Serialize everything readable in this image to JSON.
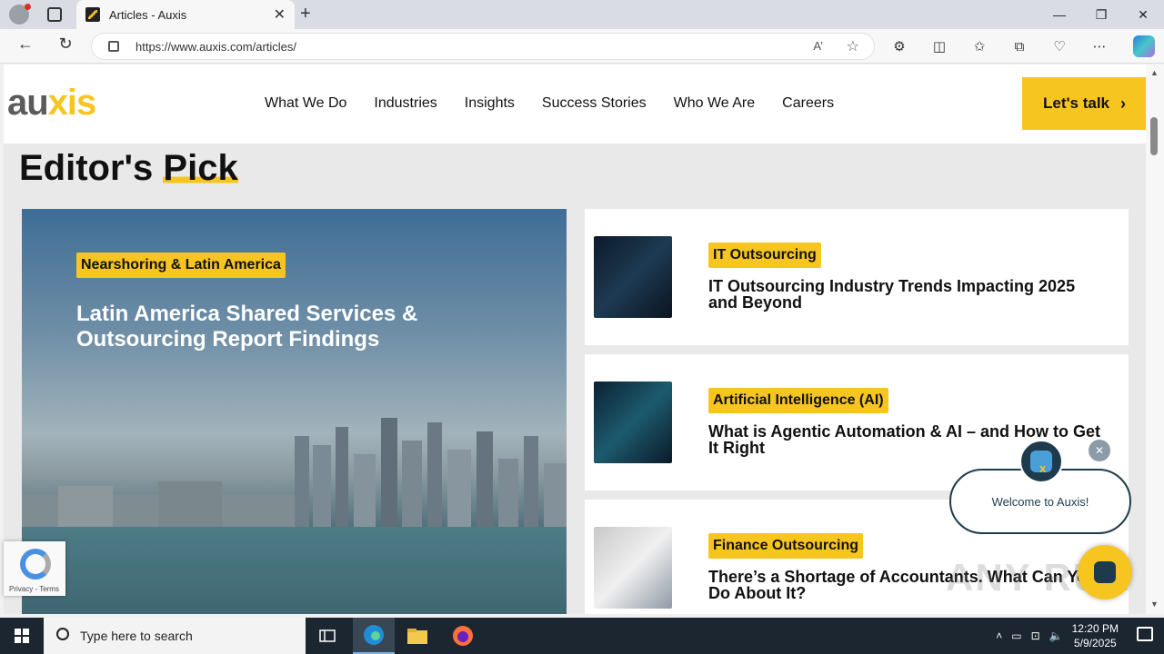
{
  "browser": {
    "tab_title": "Articles - Auxis",
    "url": "https://www.auxis.com/articles/",
    "read_aloud": "A’"
  },
  "site": {
    "logo_part1": "au",
    "logo_part2": "xis",
    "menu": [
      "What We Do",
      "Industries",
      "Insights",
      "Success Stories",
      "Who We Are",
      "Careers"
    ],
    "cta": "Let's talk",
    "section_title_part1": "Editor's ",
    "section_title_part2": "Pick"
  },
  "hero": {
    "tag": "Nearshoring & Latin America",
    "title": "Latin America Shared Services & Outsourcing Report Findings"
  },
  "cards": [
    {
      "tag": "IT Outsourcing",
      "title": "IT Outsourcing Industry Trends Impacting 2025 and Beyond"
    },
    {
      "tag": "Artificial Intelligence (AI)",
      "title": "What is Agentic Automation & AI – and How to Get It Right"
    },
    {
      "tag": "Finance Outsourcing",
      "title": "There’s a Shortage of Accountants. What Can You Do About It?"
    }
  ],
  "chat": {
    "welcome": "Welcome to Auxis!"
  },
  "recaptcha": {
    "text": "Privacy - Terms"
  },
  "watermark": "ANY RUN",
  "taskbar": {
    "search_placeholder": "Type here to search",
    "time": "12:20 PM",
    "date": "5/9/2025"
  },
  "colors": {
    "brand_yellow": "#f7c520",
    "brand_gray": "#5b5b5b",
    "chat_navy": "#1e3b4d"
  }
}
